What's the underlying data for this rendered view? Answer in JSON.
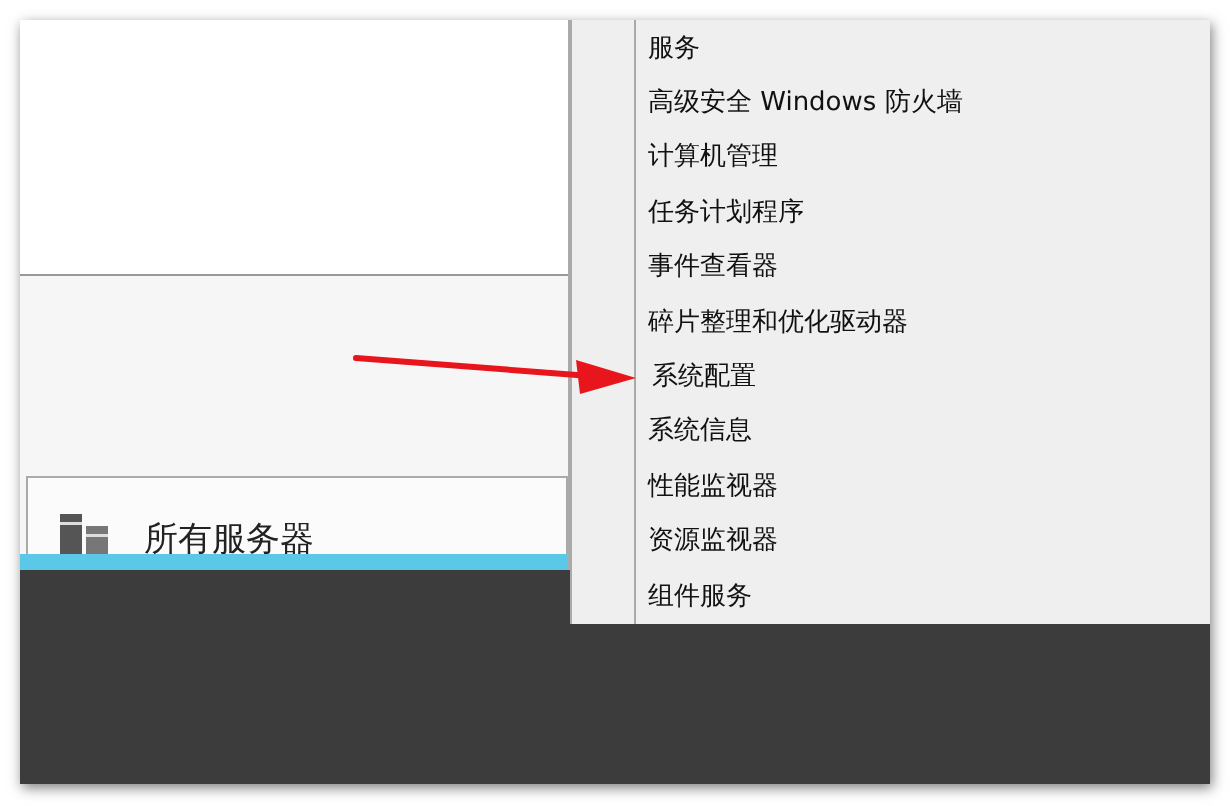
{
  "tile": {
    "title": "所有服务器"
  },
  "tools_menu": {
    "items": [
      {
        "label": "服务"
      },
      {
        "label": "高级安全 Windows 防火墙"
      },
      {
        "label": "计算机管理"
      },
      {
        "label": "任务计划程序"
      },
      {
        "label": "事件查看器"
      },
      {
        "label": "碎片整理和优化驱动器"
      },
      {
        "label": "系统配置"
      },
      {
        "label": "系统信息"
      },
      {
        "label": "性能监视器"
      },
      {
        "label": "资源监视器"
      },
      {
        "label": "组件服务"
      }
    ]
  }
}
